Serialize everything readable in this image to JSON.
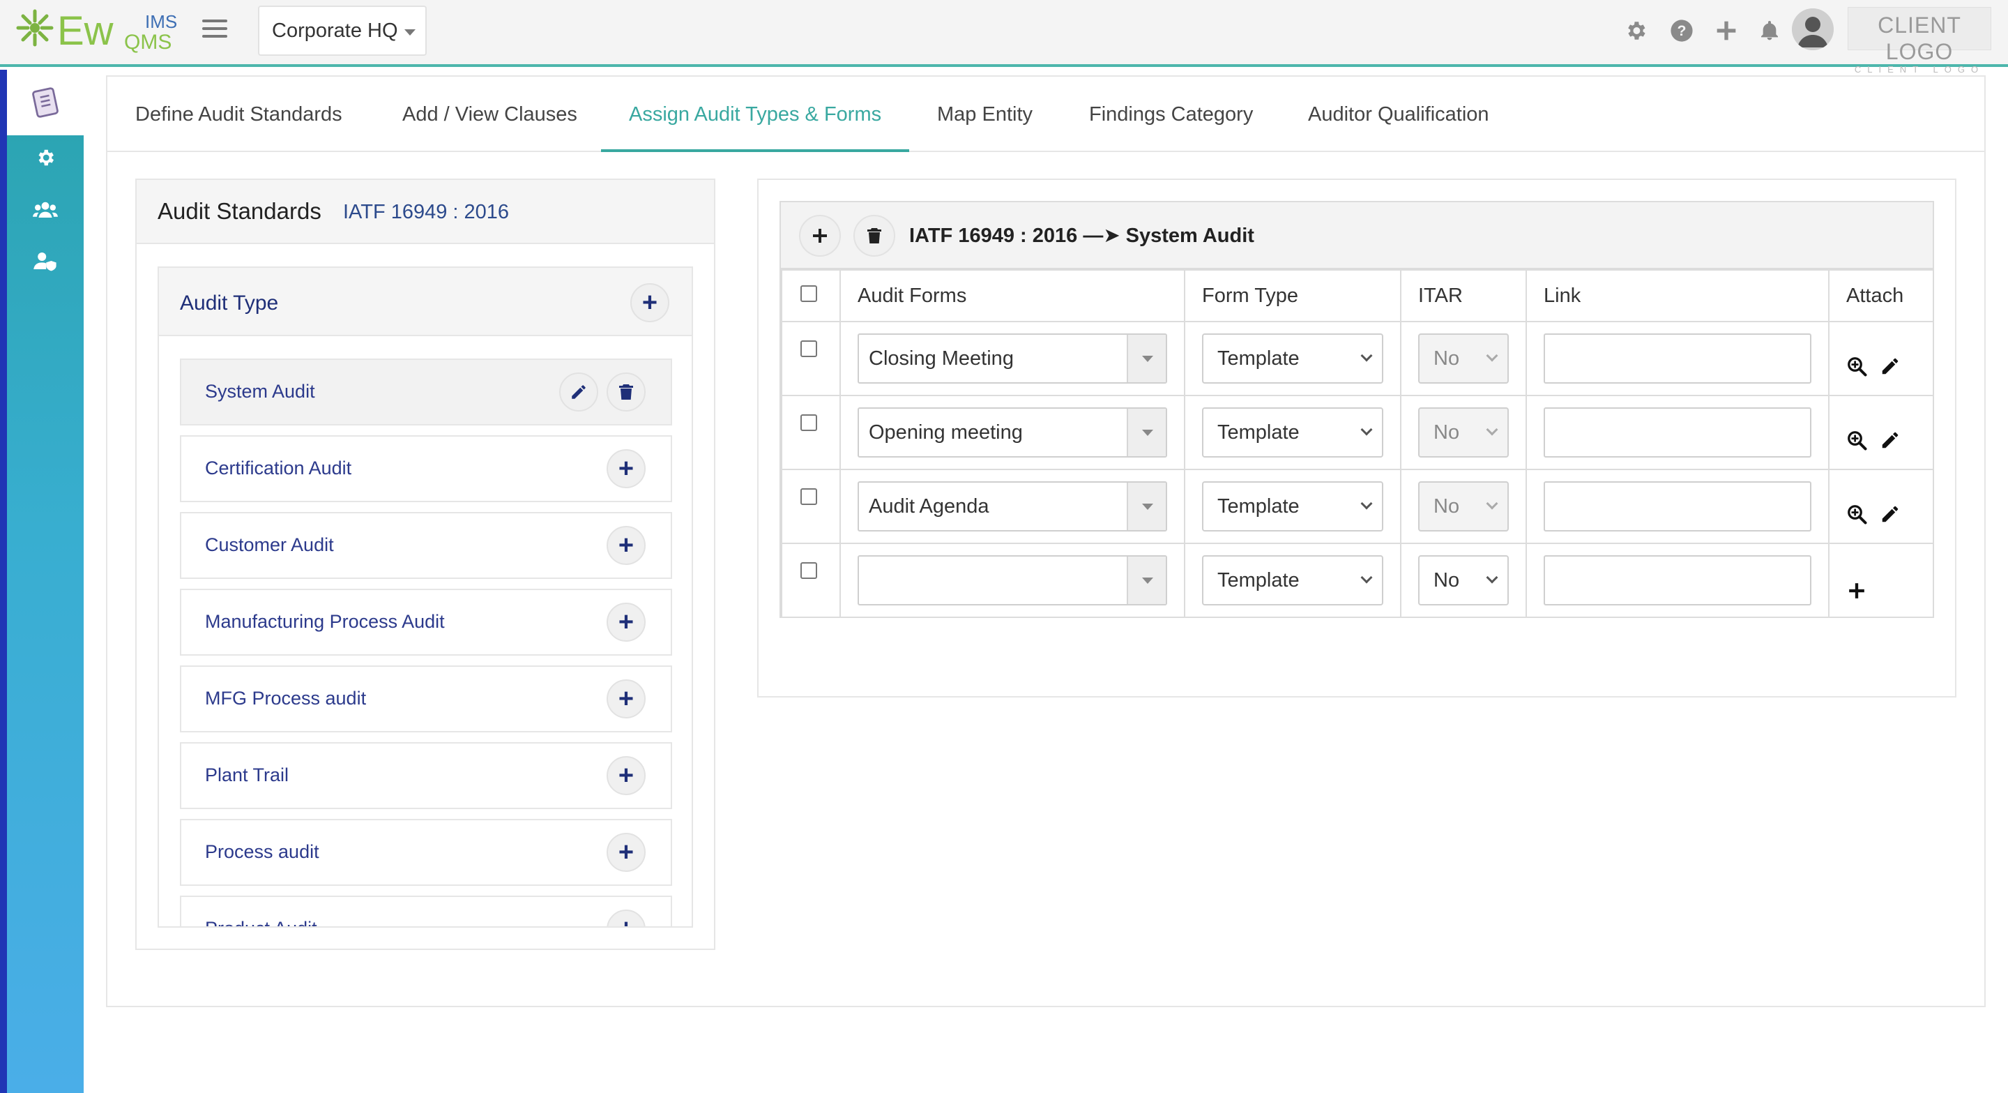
{
  "header": {
    "app_logo_main": "Ew",
    "app_logo_ims": "IMS",
    "app_logo_qms": "QMS",
    "location": "Corporate HQ",
    "client_logo": "CLIENT LOGO",
    "client_logo_sub": "CLIENT LOGO",
    "icons": [
      "gear-icon",
      "help-icon",
      "plus-icon",
      "bell-icon",
      "user-avatar"
    ]
  },
  "sidebar": {
    "icons": [
      "audit-document-icon",
      "settings-gear-icon",
      "users-group-icon",
      "user-shield-icon"
    ]
  },
  "tabs": [
    {
      "label": "Define Audit Standards",
      "active": false
    },
    {
      "label": "Add / View Clauses",
      "active": false
    },
    {
      "label": "Assign Audit Types & Forms",
      "active": true
    },
    {
      "label": "Map Entity",
      "active": false
    },
    {
      "label": "Findings Category",
      "active": false
    },
    {
      "label": "Auditor Qualification",
      "active": false
    }
  ],
  "left_panel": {
    "title": "Audit Standards",
    "standard": "IATF 16949 : 2016",
    "audit_type_header": "Audit Type",
    "items": [
      {
        "label": "System Audit",
        "selected": true
      },
      {
        "label": "Certification Audit",
        "selected": false
      },
      {
        "label": "Customer Audit",
        "selected": false
      },
      {
        "label": "Manufacturing Process Audit",
        "selected": false
      },
      {
        "label": "MFG Process audit",
        "selected": false
      },
      {
        "label": "Plant Trail",
        "selected": false
      },
      {
        "label": "Process audit",
        "selected": false
      },
      {
        "label": "Product Audit",
        "selected": false
      }
    ]
  },
  "right_panel": {
    "breadcrumb": "IATF 16949 : 2016 —➤ System Audit",
    "columns": [
      "",
      "Audit Forms",
      "Form Type",
      "ITAR",
      "Link",
      "Attach"
    ],
    "rows": [
      {
        "form": "Closing Meeting",
        "form_type": "Template",
        "itar": "No",
        "itar_disabled": true,
        "link": "",
        "attach": "view-edit"
      },
      {
        "form": "Opening meeting",
        "form_type": "Template",
        "itar": "No",
        "itar_disabled": true,
        "link": "",
        "attach": "view-edit"
      },
      {
        "form": "Audit Agenda",
        "form_type": "Template",
        "itar": "No",
        "itar_disabled": true,
        "link": "",
        "attach": "view-edit"
      },
      {
        "form": "",
        "form_type": "Template",
        "itar": "No",
        "itar_disabled": false,
        "link": "",
        "attach": "add"
      }
    ]
  },
  "colors": {
    "accent_teal": "#39a8a0",
    "navy_text": "#1f2f78",
    "rail_blue": "#2035b5",
    "header_bg": "#f4f4f4"
  }
}
